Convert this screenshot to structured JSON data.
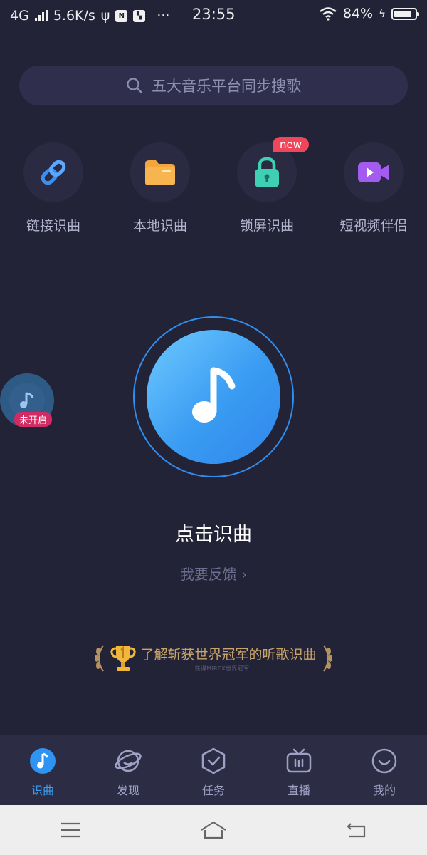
{
  "status_bar": {
    "network": "4G",
    "speed": "5.6K/s",
    "more": "···",
    "time": "23:55",
    "battery": "84%"
  },
  "search": {
    "placeholder": "五大音乐平台同步搜歌"
  },
  "features": [
    {
      "label": "链接识曲",
      "icon": "link-icon",
      "color": "#3a8fef"
    },
    {
      "label": "本地识曲",
      "icon": "folder-icon",
      "color": "#f4a53c"
    },
    {
      "label": "锁屏识曲",
      "icon": "lock-icon",
      "color": "#3fcfb4",
      "badge": "new"
    },
    {
      "label": "短视频伴侣",
      "icon": "video-icon",
      "color": "#a45cf0"
    }
  ],
  "side_widget": {
    "tag": "未开启"
  },
  "main": {
    "title": "点击识曲",
    "feedback": "我要反馈 ›"
  },
  "award": {
    "text": "了解斩获世界冠军的听歌识曲",
    "sub": "获得MIREX世界冠军"
  },
  "tabs": [
    {
      "label": "识曲",
      "icon": "music-note-icon",
      "active": true
    },
    {
      "label": "发现",
      "icon": "planet-icon",
      "active": false
    },
    {
      "label": "任务",
      "icon": "task-shield-icon",
      "active": false
    },
    {
      "label": "直播",
      "icon": "tv-icon",
      "active": false
    },
    {
      "label": "我的",
      "icon": "smile-face-icon",
      "active": false
    }
  ],
  "colors": {
    "background": "#232338",
    "accent": "#3d9ef5",
    "badge": "#f0465b"
  }
}
